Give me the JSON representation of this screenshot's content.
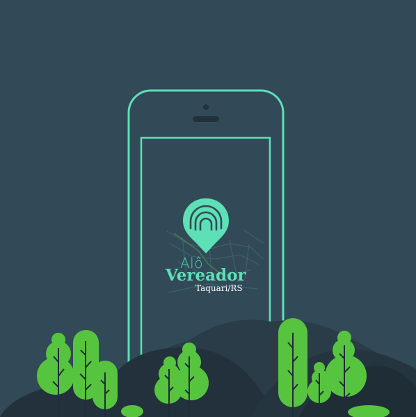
{
  "app": {
    "brand_line1": "Alô",
    "brand_line2": "Vereador",
    "brand_line3": "Taquari/RS"
  },
  "colors": {
    "background": "#324a58",
    "accent": "#5ee0b6",
    "tree_green": "#57c43f",
    "hill_dark": "#22313b"
  },
  "icons": [
    "map-pin-icon",
    "signal-waves-icon"
  ]
}
